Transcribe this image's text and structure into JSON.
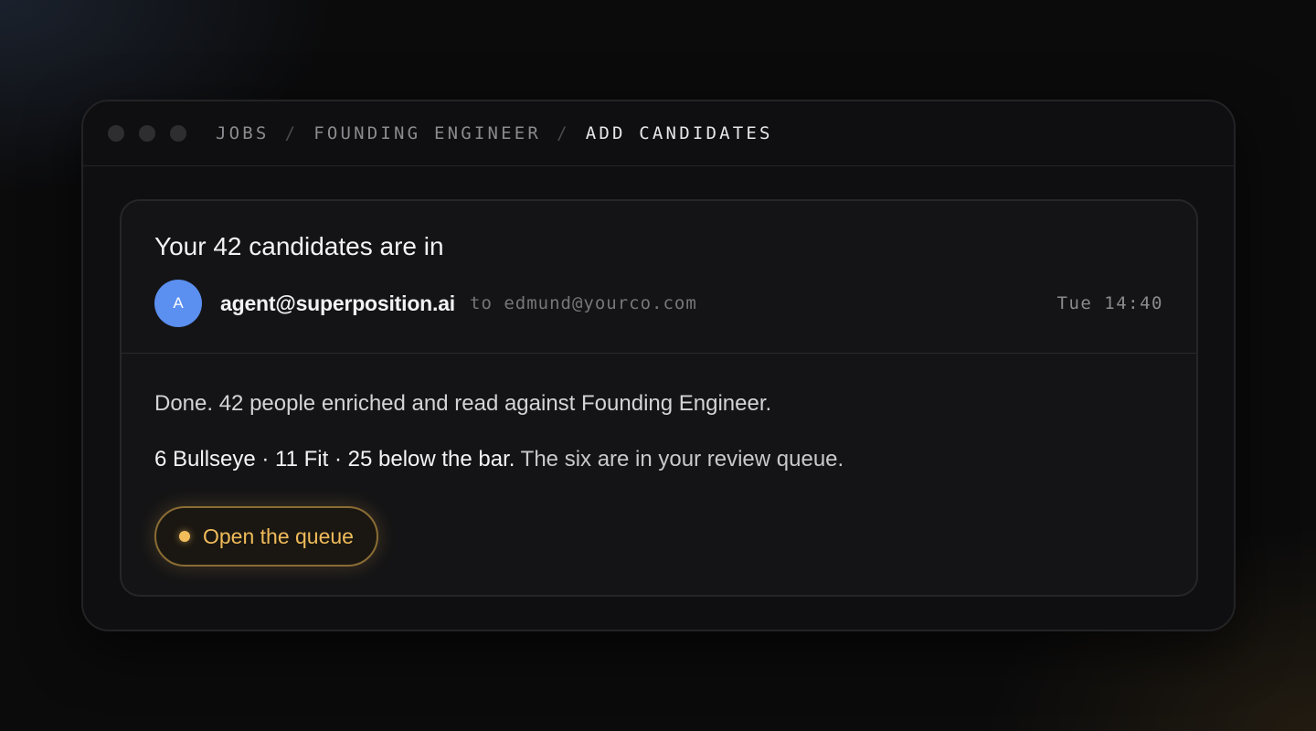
{
  "window": {
    "breadcrumb": [
      "JOBS",
      "FOUNDING ENGINEER",
      "ADD CANDIDATES"
    ],
    "breadcrumb_separator": "/"
  },
  "email": {
    "subject": "Your 42 candidates are in",
    "avatar_initial": "A",
    "from": "agent@superposition.ai",
    "to_text": "to edmund@yourco.com",
    "time": "Tue 14:40",
    "body_line1": "Done. 42 people enriched and read against Founding Engineer.",
    "body_line2_strong": "6 Bullseye · 11 Fit · 25 below the bar.",
    "body_line2_rest": " The six are in your review queue.",
    "cta_label": "Open the queue"
  },
  "colors": {
    "avatar": "#5b8ff0",
    "accent": "#f0bb5a",
    "background": "#0b0b0c"
  },
  "icons": {
    "window_controls": [
      "window-dot-icon",
      "window-dot-icon",
      "window-dot-icon"
    ],
    "cta": "status-dot-icon"
  }
}
